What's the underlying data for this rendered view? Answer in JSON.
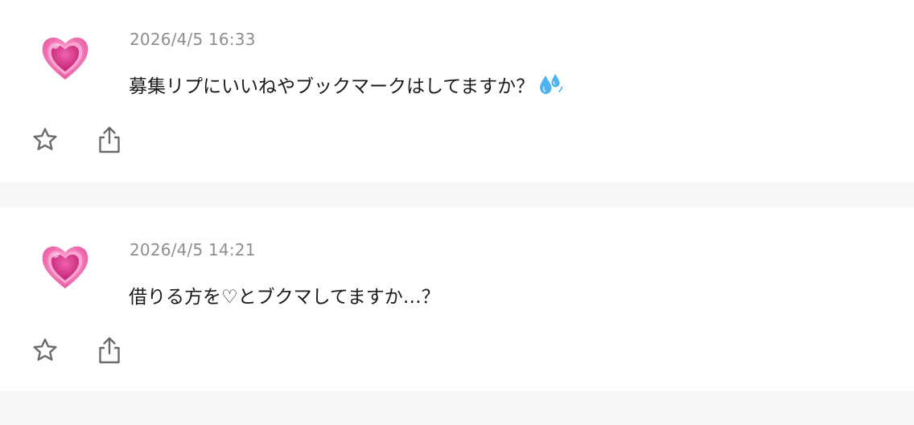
{
  "posts": [
    {
      "avatar_icon": "growing-heart-icon",
      "timestamp": "2026/4/5 16:33",
      "message": "募集リプにいいねやブックマークはしてますか？",
      "message_emoji": "sweat-droplets-icon",
      "actions": {
        "favorite_icon": "star-icon",
        "share_icon": "share-icon"
      }
    },
    {
      "avatar_icon": "growing-heart-icon",
      "timestamp": "2026/4/5 14:21",
      "message": "借りる方を♡とブクマしてますか…？",
      "actions": {
        "favorite_icon": "star-icon",
        "share_icon": "share-icon"
      }
    }
  ],
  "colors": {
    "background": "#ffffff",
    "divider": "#f7f7f7",
    "timestamp": "#8e8e8e",
    "text": "#1a1a1a",
    "icon": "#6b6b6b",
    "heart": "#e04f9a"
  }
}
